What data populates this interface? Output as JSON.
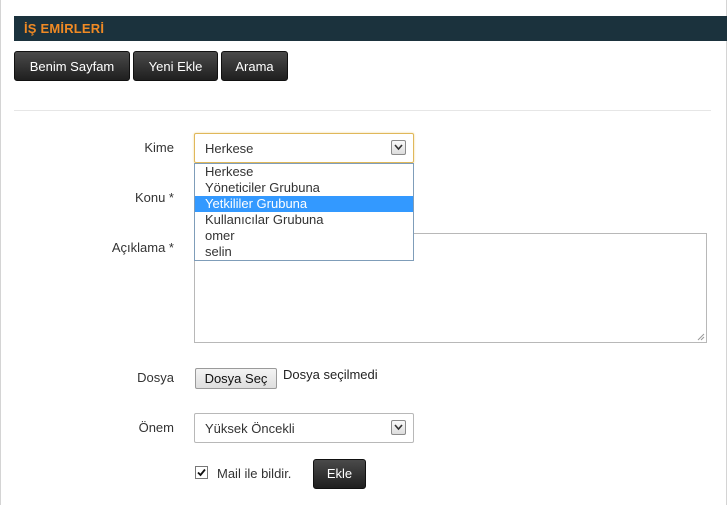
{
  "header": {
    "title": "İŞ EMİRLERİ",
    "title_color": "#f08a24",
    "bar_color": "#1b323d"
  },
  "toolbar": {
    "buttons": [
      "Benim Sayfam",
      "Yeni Ekle",
      "Arama"
    ]
  },
  "form": {
    "kime": {
      "label": "Kime",
      "value": "Herkese",
      "options": [
        "Herkese",
        "Yöneticiler Grubuna",
        "Yetkililer Grubuna",
        "Kullanıcılar Grubuna",
        "omer",
        "selin"
      ],
      "highlighted_option": "Yetkililer Grubuna",
      "dropdown_open": true
    },
    "konu": {
      "label": "Konu *"
    },
    "aciklama": {
      "label": "Açıklama *",
      "value": ""
    },
    "dosya": {
      "label": "Dosya",
      "button_label": "Dosya Seç",
      "status": "Dosya seçilmedi"
    },
    "onem": {
      "label": "Önem",
      "value": "Yüksek Öncekli"
    },
    "mail": {
      "label": "Mail ile bildir.",
      "checked": true
    },
    "submit_label": "Ekle"
  },
  "highlight_color": "#3399ff"
}
